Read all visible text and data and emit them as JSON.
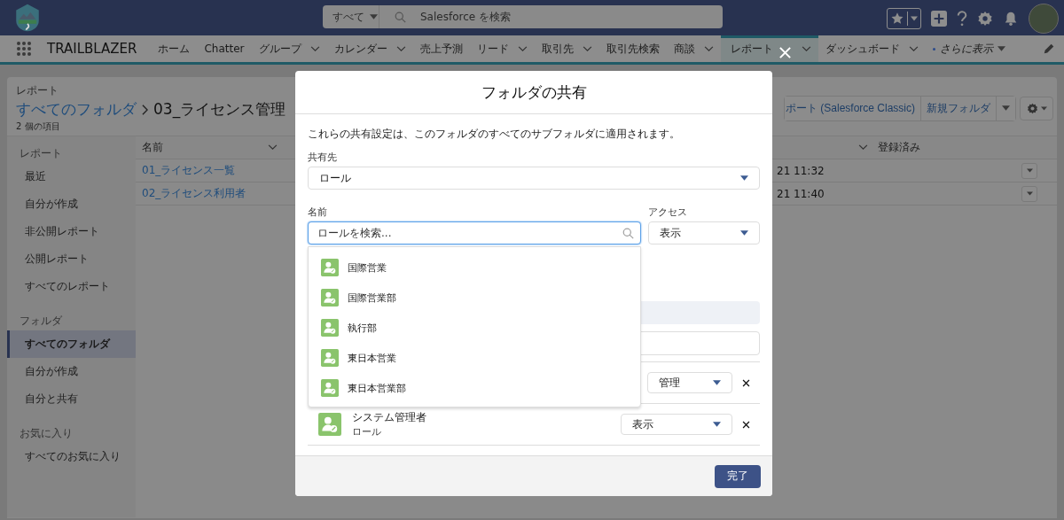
{
  "header": {
    "search_scope": "すべて",
    "search_placeholder": "Salesforce を検索"
  },
  "nav": {
    "app_name": "TRAILBLAZER",
    "tabs": [
      {
        "label": "ホーム",
        "has_menu": false,
        "selected": false
      },
      {
        "label": "Chatter",
        "has_menu": false,
        "selected": false
      },
      {
        "label": "グループ",
        "has_menu": true,
        "selected": false
      },
      {
        "label": "カレンダー",
        "has_menu": true,
        "selected": false
      },
      {
        "label": "売上予測",
        "has_menu": false,
        "selected": false
      },
      {
        "label": "リード",
        "has_menu": true,
        "selected": false
      },
      {
        "label": "取引先",
        "has_menu": true,
        "selected": false
      },
      {
        "label": "取引先検索",
        "has_menu": false,
        "selected": false
      },
      {
        "label": "商談",
        "has_menu": true,
        "selected": false
      },
      {
        "label": "レポート",
        "has_menu": true,
        "selected": true
      },
      {
        "label": "ダッシュボード",
        "has_menu": true,
        "selected": false
      }
    ],
    "more": "さらに表示"
  },
  "page": {
    "object_label": "レポート",
    "breadcrumb": {
      "parent": "すべてのフォルダ",
      "current": "03_ライセンス管理"
    },
    "item_count": "2 個の項目",
    "buttons": [
      "ポート (Salesforce Classic)",
      "新規フォルダ"
    ]
  },
  "sidebar": {
    "sections": [
      {
        "title": "レポート",
        "items": [
          {
            "label": "最近",
            "selected": false
          },
          {
            "label": "自分が作成",
            "selected": false
          },
          {
            "label": "非公開レポート",
            "selected": false
          },
          {
            "label": "公開レポート",
            "selected": false
          },
          {
            "label": "すべてのレポート",
            "selected": false
          }
        ]
      },
      {
        "title": "フォルダ",
        "items": [
          {
            "label": "すべてのフォルダ",
            "selected": true
          },
          {
            "label": "自分が作成",
            "selected": false
          },
          {
            "label": "自分と共有",
            "selected": false
          }
        ]
      },
      {
        "title": "お気に入り",
        "items": [
          {
            "label": "すべてのお気に入り",
            "selected": false
          }
        ]
      }
    ]
  },
  "table": {
    "columns": [
      "名前",
      "登録済み"
    ],
    "rows": [
      {
        "name": "01_ライセンス一覧",
        "column_3": "21 11:32"
      },
      {
        "name": "02_ライセンス利用者",
        "column_3": "21 11:40"
      }
    ]
  },
  "dialog": {
    "title": "フォルダの共有",
    "description": "これらの共有設定は、このフォルダのすべてのサブフォルダに適用されます。",
    "share_with": {
      "label": "共有先",
      "value": "ロール"
    },
    "name": {
      "label": "名前",
      "placeholder": "ロールを検索..."
    },
    "access": {
      "label": "アクセス",
      "value": "表示"
    },
    "suggestions": [
      "国際営業",
      "国際営業部",
      "執行部",
      "東日本営業",
      "東日本営業部"
    ],
    "shares": [
      {
        "access": "管理"
      },
      {
        "name": "システム管理者",
        "type": "ロール",
        "access": "表示"
      }
    ],
    "done_button": "完了"
  }
}
